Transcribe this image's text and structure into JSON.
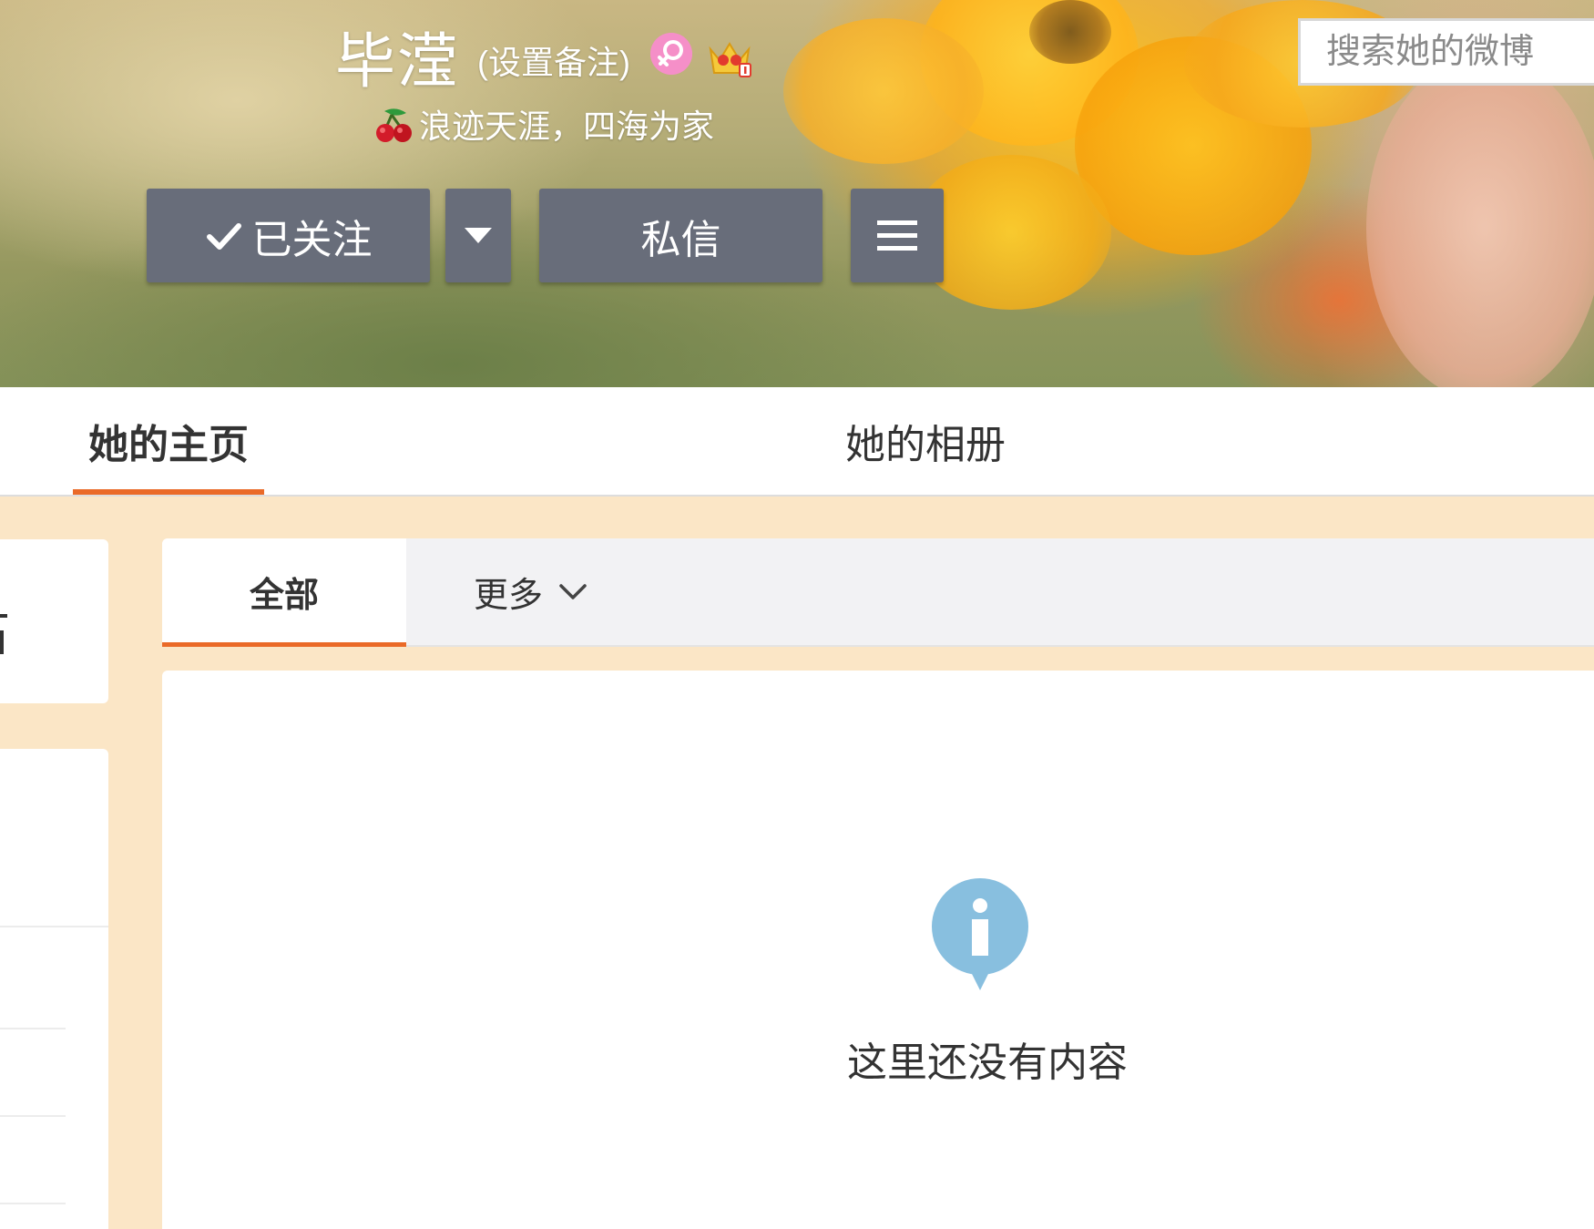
{
  "profile": {
    "name": "毕滢",
    "remark_link": "(设置备注)",
    "bio": "浪迹天涯，四海为家",
    "gender_icon": "female-icon",
    "vip_icon": "crown-icon",
    "bio_icon": "cherry-icon"
  },
  "actions": {
    "follow_label": "已关注",
    "message_label": "私信",
    "follow_icon": "check-icon",
    "dropdown_icon": "caret-down-icon",
    "menu_icon": "hamburger-menu-icon"
  },
  "tabs": [
    {
      "label": "她的主页",
      "active": true
    },
    {
      "label": "她的相册",
      "active": false
    }
  ],
  "feed_filter": {
    "all_label": "全部",
    "more_label": "更多",
    "search_placeholder": "搜索她的微博"
  },
  "empty_state": {
    "message": "这里还没有内容",
    "icon": "info-bubble-icon"
  },
  "colors": {
    "accent": "#ea6a28",
    "button_bg": "#686d7a",
    "page_bg": "#fbe6c6",
    "info_icon": "#88bfdf"
  }
}
